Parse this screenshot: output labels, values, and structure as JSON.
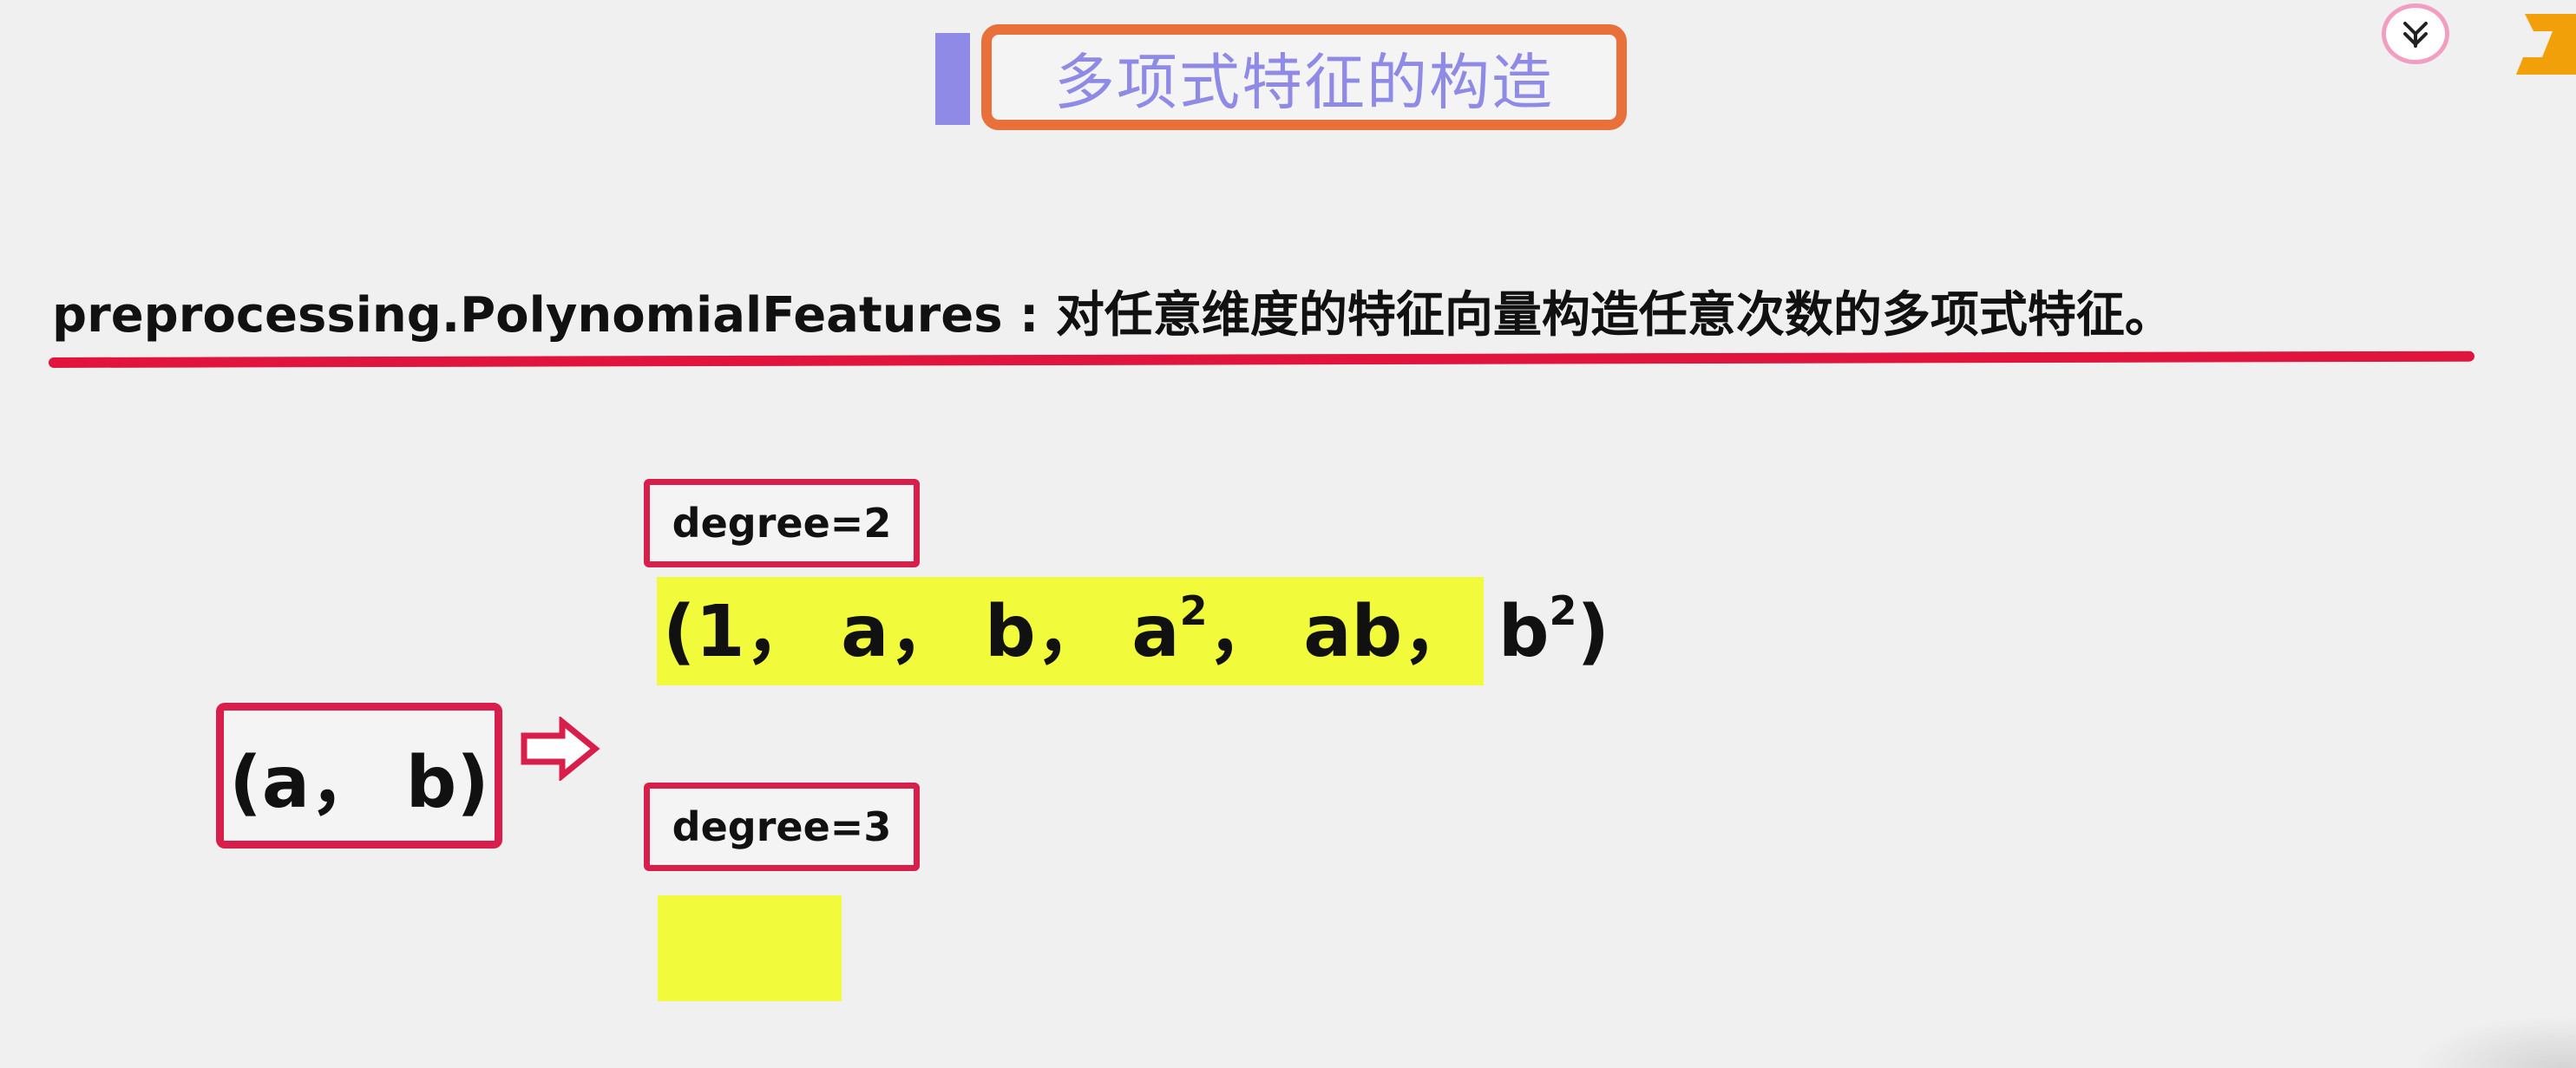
{
  "slide": {
    "title": "多项式特征的构造",
    "description": "preprocessing.PolynomialFeatures : 对任意维度的特征向量构造任意次数的多项式特征。"
  },
  "input": {
    "vector": "(a， b)"
  },
  "degree2": {
    "label": "degree=2",
    "terms": [
      "(1，",
      "a，",
      "b，",
      "a",
      "2",
      "，",
      "ab，",
      "b",
      "2",
      ")"
    ]
  },
  "degree3": {
    "label": "degree=3"
  },
  "colors": {
    "title_accent": "#8e8ae6",
    "title_border": "#e8703a",
    "red_accent": "#d81e4a",
    "highlight": "#f2fa3c"
  },
  "icons": {
    "arrow": "right-arrow-icon",
    "logo": "app-logo-icon",
    "brand": "brand-icon"
  }
}
